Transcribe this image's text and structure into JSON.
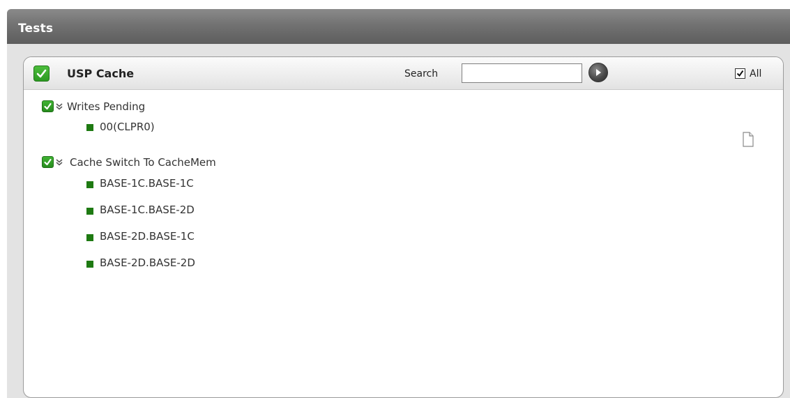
{
  "window": {
    "title": "Tests"
  },
  "panel": {
    "title": "USP Cache",
    "search": {
      "label": "Search",
      "value": "",
      "placeholder": ""
    },
    "all": {
      "label": "All",
      "checked": true
    }
  },
  "groups": [
    {
      "label": "Writes Pending",
      "checked": true,
      "expanded": true,
      "items": [
        "00(CLPR0)"
      ]
    },
    {
      "label": "Cache Switch To CacheMem",
      "checked": true,
      "expanded": true,
      "items": [
        "BASE-1C.BASE-1C",
        "BASE-1C.BASE-2D",
        "BASE-2D.BASE-1C",
        "BASE-2D.BASE-2D"
      ]
    }
  ],
  "colors": {
    "check_green": "#2c9a22",
    "bullet_green": "#1e7a12",
    "titlebar": "#727272"
  },
  "icons": {
    "panel_check": "check-icon",
    "go": "go-arrow-icon",
    "expand": "chevron-down-icon",
    "doc": "document-icon"
  }
}
